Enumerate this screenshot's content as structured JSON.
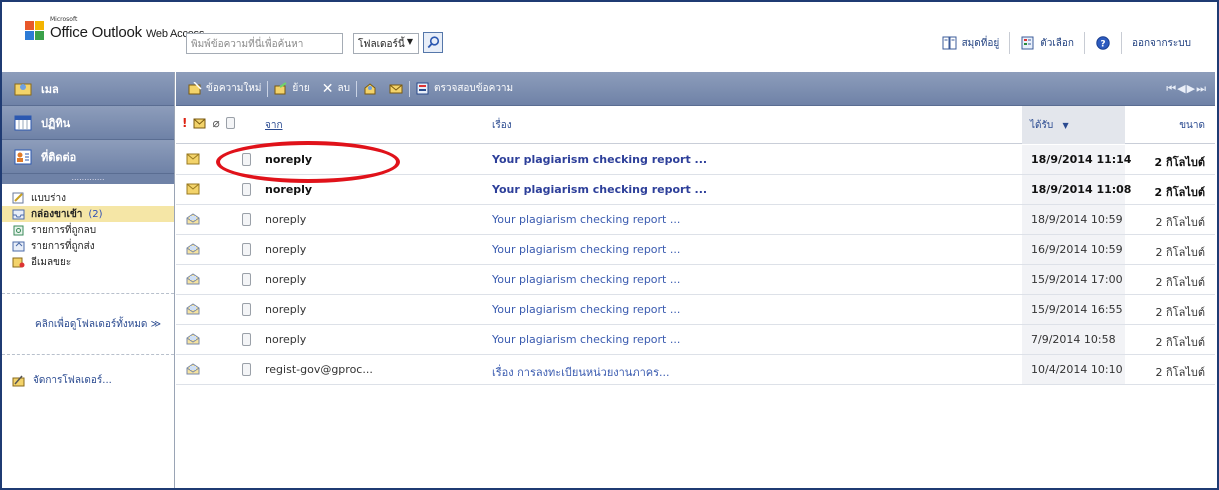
{
  "header": {
    "logo_small": "Microsoft",
    "logo_main": "Office Outlook",
    "logo_sub": "Web Access",
    "search_placeholder": "พิมพ์ข้อความที่นี่เพื่อค้นหา",
    "folder_select": "โฟลเดอร์นี้",
    "links": [
      {
        "label": "สมุดที่อยู่",
        "icon": "address-book-icon"
      },
      {
        "label": "ตัวเลือก",
        "icon": "options-icon"
      },
      {
        "label": "",
        "icon": "help-icon"
      },
      {
        "label": "ออกจากระบบ",
        "icon": ""
      }
    ]
  },
  "leftnav": {
    "sections": [
      {
        "label": "เมล",
        "icon": "mail-icon"
      },
      {
        "label": "ปฏิทิน",
        "icon": "calendar-icon"
      },
      {
        "label": "ที่ติดต่อ",
        "icon": "contacts-icon"
      }
    ],
    "folders": [
      {
        "label": "แบบร่าง",
        "icon": "drafts-icon",
        "count": ""
      },
      {
        "label": "กล่องขาเข้า",
        "icon": "inbox-icon",
        "count": "(2)"
      },
      {
        "label": "รายการที่ถูกลบ",
        "icon": "deleted-items-icon",
        "count": ""
      },
      {
        "label": "รายการที่ถูกส่ง",
        "icon": "sent-items-icon",
        "count": ""
      },
      {
        "label": "อีเมลขยะ",
        "icon": "junk-email-icon",
        "count": ""
      }
    ],
    "all_folders_link": "คลิกเพื่อดูโฟลเดอร์ทั้งหมด ≫",
    "manage_folders": "จัดการโฟลเดอร์..."
  },
  "toolbar": {
    "new_message": "ข้อความใหม่",
    "move": "ย้าย",
    "delete": "ลบ",
    "check_messages": "ตรวจสอบข้อความ",
    "pager": "⏮◀▶⏭"
  },
  "list": {
    "col_from": "จาก",
    "col_subject": "เรื่อง",
    "col_received": "ได้รับ",
    "col_size": "ขนาด",
    "rows": [
      {
        "from": "noreply",
        "subject": "Your plagiarism checking report ...",
        "received": "18/9/2014 11:14",
        "size": "2 กิโลไบต์",
        "unread": true
      },
      {
        "from": "noreply",
        "subject": "Your plagiarism checking report ...",
        "received": "18/9/2014 11:08",
        "size": "2 กิโลไบต์",
        "unread": true
      },
      {
        "from": "noreply",
        "subject": "Your plagiarism checking report ...",
        "received": "18/9/2014 10:59",
        "size": "2 กิโลไบต์",
        "unread": false
      },
      {
        "from": "noreply",
        "subject": "Your plagiarism checking report ...",
        "received": "16/9/2014 10:59",
        "size": "2 กิโลไบต์",
        "unread": false
      },
      {
        "from": "noreply",
        "subject": "Your plagiarism checking report ...",
        "received": "15/9/2014 17:00",
        "size": "2 กิโลไบต์",
        "unread": false
      },
      {
        "from": "noreply",
        "subject": "Your plagiarism checking report ...",
        "received": "15/9/2014 16:55",
        "size": "2 กิโลไบต์",
        "unread": false
      },
      {
        "from": "noreply",
        "subject": "Your plagiarism checking report ...",
        "received": "7/9/2014 10:58",
        "size": "2 กิโลไบต์",
        "unread": false
      },
      {
        "from": "regist-gov@gproc...",
        "subject": "เรื่อง การลงทะเบียนหน่วยงานภาคร...",
        "received": "10/4/2014 10:10",
        "size": "2 กิโลไบต์",
        "unread": false
      }
    ]
  },
  "colors": {
    "toolbar": "#7b8db0",
    "highlight": "#e0121a",
    "active_folder": "#f5e6a6",
    "link": "#2a4a90"
  }
}
